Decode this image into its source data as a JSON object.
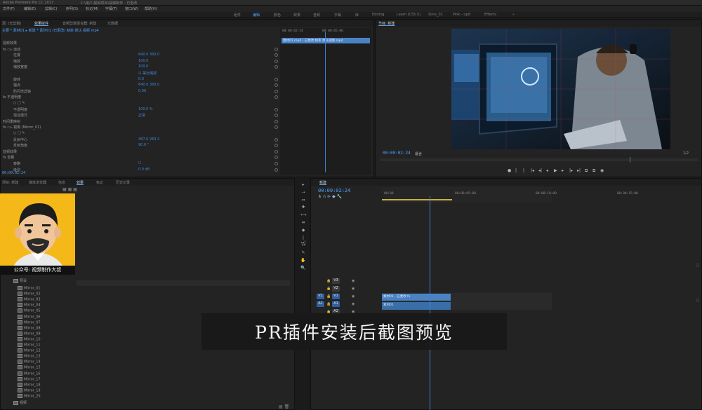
{
  "titlebar": {
    "items": [
      "Adobe Premiere Pro CC 2017",
      "C:\\用户\\视频项目\\视频制作 - 已更改"
    ]
  },
  "menubar": {
    "items": [
      "文件(F)",
      "编辑(E)",
      "剪辑(C)",
      "序列(S)",
      "标记(M)",
      "字幕(T)",
      "窗口(W)",
      "帮助(H)"
    ]
  },
  "workspaces": {
    "items": [
      "组件",
      "编辑",
      "颜色",
      "效果",
      "音频",
      "字幕",
      "库",
      "Editing",
      "Learn (CS5.5)",
      "Sons_01",
      "Pink - upd",
      "Effects"
    ],
    "active_index": 1
  },
  "effect_controls": {
    "tabs": [
      "源: (无剪辑)",
      "效果控件",
      "音频剪辑混合器: 新建",
      "元数据"
    ],
    "active_tab": 1,
    "path": "主要 * 素材01 ▸ 新建 * 素材01 (已更改) 帧率 默认 视频 mp4",
    "rows": [
      {
        "label": "视频效果",
        "value": ""
      },
      {
        "label": "fx ▭▹ 运动",
        "value": ""
      },
      {
        "label": "位置",
        "value": "640.0    360.0"
      },
      {
        "label": "缩放",
        "value": "100.0"
      },
      {
        "label": "缩放宽度",
        "value": "100.0"
      },
      {
        "label": "",
        "value": "☑ 等比缩放"
      },
      {
        "label": "旋转",
        "value": "0.0"
      },
      {
        "label": "锚点",
        "value": "640.0    360.0"
      },
      {
        "label": "防闪烁滤镜",
        "value": "0.00"
      },
      {
        "label": "fx 不透明度",
        "value": ""
      },
      {
        "label": "○ □ ✎",
        "value": ""
      },
      {
        "label": "不透明度",
        "value": "100.0 %"
      },
      {
        "label": "混合模式",
        "value": "正常"
      },
      {
        "label": "时间重映射",
        "value": ""
      },
      {
        "label": "fx ▭▹ 镜像 (Mirror_01)",
        "value": ""
      },
      {
        "label": "○ □ ✎",
        "value": ""
      },
      {
        "label": "反射中心",
        "value": "487.0    263.2"
      },
      {
        "label": "反射角度",
        "value": "90.0 °"
      },
      {
        "label": "音频效果",
        "value": ""
      },
      {
        "label": "fx 音量",
        "value": ""
      },
      {
        "label": "旁路",
        "value": "☐"
      },
      {
        "label": "级别",
        "value": "0.0 dB"
      }
    ],
    "mini_clip": "素材01.mp4 - 已更改 帧率 默认视频 mp4",
    "mini_time_a": "00:00:02:24",
    "mini_time_b": "00:00:05:00",
    "footer_time": "00:00:02:24"
  },
  "program": {
    "tab": "节目: 新建",
    "timecode": "00:00:02:24",
    "fit": "适合",
    "fraction": "1/2",
    "controls": [
      "●",
      "|",
      "|",
      "|◂",
      "◂|",
      "◂",
      "▶",
      "▸",
      "|▸",
      "▸|",
      "⧉",
      "⧉",
      "◉"
    ]
  },
  "project": {
    "tabs": [
      "项目: 新建",
      "媒体浏览器",
      "信息",
      "效果",
      "标记",
      "历史记录"
    ],
    "active_tab": 3,
    "folder": "预设",
    "items": [
      "Mirror_01",
      "Mirror_02",
      "Mirror_03",
      "Mirror_04",
      "Mirror_05",
      "Mirror_06",
      "Mirror_07",
      "Mirror_08",
      "Mirror_09",
      "Mirror_10",
      "Mirror_11",
      "Mirror_12",
      "Mirror_13",
      "Mirror_14",
      "Mirror_15",
      "Mirror_16",
      "Mirror_17",
      "Mirror_18",
      "Mirror_19",
      "Mirror_20"
    ],
    "footer_folder": "视频",
    "accent": "#4ea0ff"
  },
  "avatar": {
    "label": "公众号: 视频制作大叔",
    "bg": "#f4b819"
  },
  "tools": [
    "▸",
    "⇢",
    "⇔",
    "✚",
    "⟷",
    "⇹",
    "◆",
    "|↔|",
    "↔",
    "✎",
    "✋",
    "🔍"
  ],
  "timeline": {
    "tab": "新建",
    "timecode": "00:00:02:24",
    "ruler": [
      "00:00",
      "00:00:05:00",
      "00:00:10:00",
      "00:00:15:00"
    ],
    "tracks": [
      {
        "name": "V3"
      },
      {
        "name": "V2"
      },
      {
        "name": "V1",
        "src": "V1"
      },
      {
        "name": "A1",
        "src": "A1"
      },
      {
        "name": "A2"
      }
    ],
    "clip_v": "素材01 - 已更改 fx",
    "clip_a": "素材01"
  },
  "caption": {
    "text": "PR插件安装后截图预览"
  }
}
